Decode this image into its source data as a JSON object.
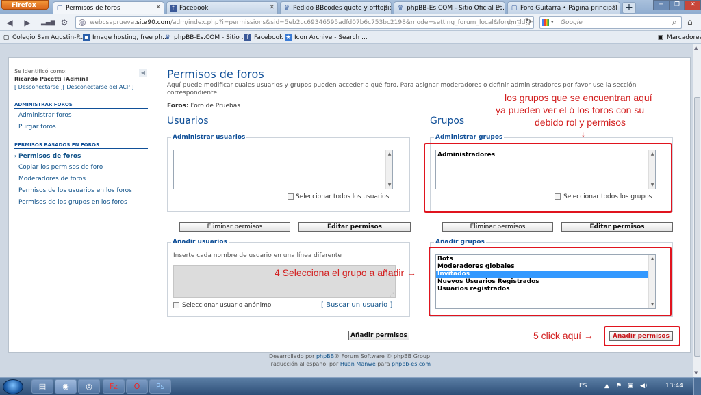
{
  "browser": {
    "menu_button": "Firefox",
    "tabs": [
      {
        "label": "Permisos de foros",
        "icon": "page-icon"
      },
      {
        "label": "Facebook",
        "icon": "facebook-icon"
      },
      {
        "label": "Pedido BBcodes quote y offtopic",
        "icon": "phpbb-icon"
      },
      {
        "label": "phpBB-Es.COM - Sitio Oficial Es...",
        "icon": "phpbb-icon"
      },
      {
        "label": "Foro Guitarra • Página principal",
        "icon": "page-icon"
      }
    ],
    "new_tab": "+",
    "url_domain_prefix": "webcsaprueva.",
    "url_domain": "site90.com",
    "url_path": "/adm/index.php?i=permissions&sid=5eb2cc69346595adfd07b6c753bc2198&mode=setting_forum_local&forum_id[]=13",
    "search_placeholder": "Google",
    "bookmarks": [
      "Colegio San Agustin-P...",
      "Image hosting, free ph...",
      "phpBB-Es.COM - Sitio ...",
      "Facebook",
      "Icon Archive - Search ..."
    ],
    "bookmarks_menu": "Marcadores"
  },
  "sidebar": {
    "logged_in_as": "Se identificó como:",
    "user": "Ricardo Pacetti [Admin]",
    "logout_links": "[ Desconectarse ][ Desconectarse del ACP ]",
    "section1_title": "ADMINISTRAR FOROS",
    "section1_items": [
      "Administrar foros",
      "Purgar foros"
    ],
    "section2_title": "PERMISOS BASADOS EN FOROS",
    "section2_items": [
      "Permisos de foros",
      "Copiar los permisos de foro",
      "Moderadores de foros",
      "Permisos de los usuarios en los foros",
      "Permisos de los grupos en los foros"
    ]
  },
  "main": {
    "title": "Permisos de foros",
    "description": "Aquí puede modificar cuales usuarios y grupos pueden acceder a qué foro. Para asignar moderadores o definir administradores por favor use la sección correspondiente.",
    "forums_label": "Foros:",
    "forums_value": "Foro de Pruebas",
    "users_heading": "Usuarios",
    "groups_heading": "Grupos",
    "manage_users_legend": "Administrar usuarios",
    "manage_groups_legend": "Administrar grupos",
    "existing_groups": [
      "Administradores"
    ],
    "select_all_users": "Seleccionar todos los usuarios",
    "select_all_groups": "Seleccionar todos los grupos",
    "remove_permissions": "Eliminar permisos",
    "edit_permissions": "Editar permisos",
    "add_users_legend": "Añadir usuarios",
    "add_users_hint": "Inserte cada nombre de usuario en una línea diferente",
    "anonymous_user": "Seleccionar usuario anónimo",
    "find_member": "[ Buscar un usuario ]",
    "add_groups_legend": "Añadir grupos",
    "group_options": [
      "Bots",
      "Moderadores globales",
      "Invitados",
      "Nuevos Usuarios Registrados",
      "Usuarios registrados"
    ],
    "selected_group": "Invitados",
    "add_permissions": "Añadir permisos"
  },
  "annotations": {
    "note1_line1": "los grupos que se encuentran aquí",
    "note1_line2": "ya pueden ver el ó los foros con su",
    "note1_line3": "debido rol y permisos",
    "note1_arrow": "↓",
    "note2": "4 Selecciona el grupo a añadir →",
    "note3": "5 click aquí →",
    "color": "#d32020"
  },
  "footer": {
    "line1_a": "Desarrollado por ",
    "line1_b": "phpBB",
    "line1_c": "® Forum Software © phpBB Group",
    "line2_a": "Traducción al español por ",
    "line2_b": "Huan Manwë",
    "line2_c": " para ",
    "line2_d": "phpbb-es.com"
  },
  "taskbar": {
    "lang": "ES",
    "time": "13:44"
  }
}
